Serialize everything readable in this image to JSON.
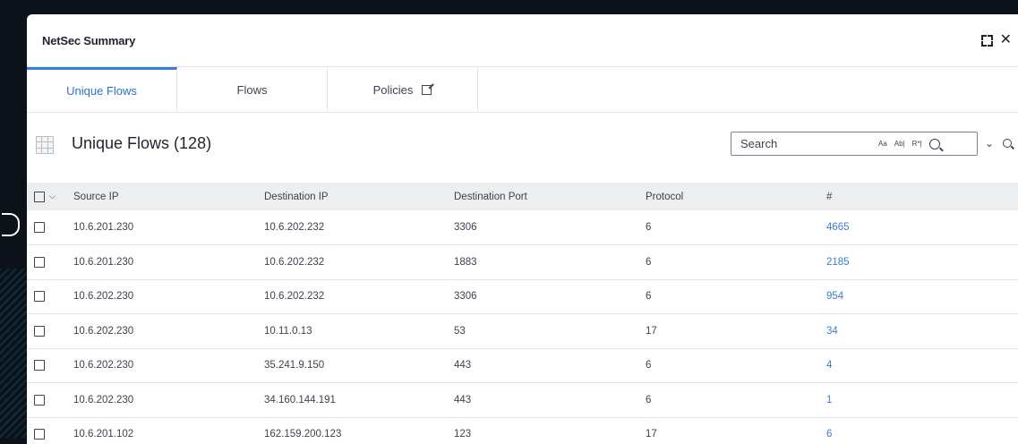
{
  "panel": {
    "title": "NetSec Summary"
  },
  "tabs": [
    {
      "label": "Unique Flows",
      "active": true
    },
    {
      "label": "Flows",
      "active": false
    },
    {
      "label": "Policies",
      "active": false
    }
  ],
  "table_title": "Unique Flows (128)",
  "search": {
    "placeholder": "Search",
    "option_match_case": "Aa",
    "option_whole_word": "Ab|",
    "option_regex": "R*|"
  },
  "columns": [
    "Source IP",
    "Destination IP",
    "Destination Port",
    "Protocol",
    "#"
  ],
  "rows": [
    {
      "src": "10.6.201.230",
      "dst": "10.6.202.232",
      "port": "3306",
      "proto": "6",
      "count": "4665"
    },
    {
      "src": "10.6.201.230",
      "dst": "10.6.202.232",
      "port": "1883",
      "proto": "6",
      "count": "2185"
    },
    {
      "src": "10.6.202.230",
      "dst": "10.6.202.232",
      "port": "3306",
      "proto": "6",
      "count": "954"
    },
    {
      "src": "10.6.202.230",
      "dst": "10.11.0.13",
      "port": "53",
      "proto": "17",
      "count": "34"
    },
    {
      "src": "10.6.202.230",
      "dst": "35.241.9.150",
      "port": "443",
      "proto": "6",
      "count": "4"
    },
    {
      "src": "10.6.202.230",
      "dst": "34.160.144.191",
      "port": "443",
      "proto": "6",
      "count": "1"
    },
    {
      "src": "10.6.201.102",
      "dst": "162.159.200.123",
      "port": "123",
      "proto": "17",
      "count": "6"
    }
  ],
  "colors": {
    "accent": "#3c7be3",
    "header_bg": "#eceef0",
    "text": "#3b4350"
  }
}
